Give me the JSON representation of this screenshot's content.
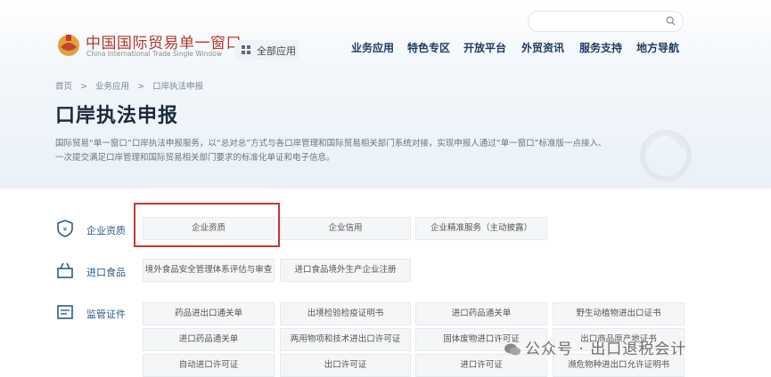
{
  "header": {
    "search_placeholder": "🔍",
    "brand_cn": "中国国际贸易单一窗口",
    "brand_en": "China International Trade Single Window",
    "all_services": "全部应用",
    "nav": [
      "业务应用",
      "特色专区",
      "开放平台",
      "外贸资讯",
      "服务支持",
      "地方导航"
    ]
  },
  "breadcrumb": [
    "首页",
    ">",
    "业务应用",
    ">",
    "口岸执法申报"
  ],
  "page": {
    "title": "口岸执法申报",
    "desc_line1": "国际贸易“单一窗口”口岸执法申报服务，以“总对总”方式与各口岸管理和国际贸易相关部门系统对接，实现申报人通过“单一窗口”标准版一点接入、",
    "desc_line2": "一次提交满足口岸管理和国际贸易相关部门要求的标准化单证和电子信息。"
  },
  "categories": [
    {
      "label": "企业资质",
      "items": [
        "企业资质",
        "企业信用",
        "企业精准服务（主动披露）"
      ]
    },
    {
      "label": "进口食品",
      "items": [
        "境外食品安全管理体系评估与审查",
        "进口食品境外生产企业注册"
      ]
    },
    {
      "label": "监管证件",
      "items": [
        "药品进出口通关单",
        "出境检验检疫证明书",
        "进口药品通关单",
        "野生动植物进出口证书",
        "进口药品通关单",
        "两用物项和技术进出口许可证",
        "固体废物进口许可证",
        "出口商品原产地证书",
        "自动进口许可证",
        "出口许可证",
        "进口许可证",
        "濒危物种进出口允许证明书"
      ]
    }
  ],
  "watermark": "公众号 · 出口退税会计",
  "colors": {
    "brand_red": "#b2392b",
    "nav_blue": "#1f3a5f",
    "highlight": "#c9362e"
  }
}
